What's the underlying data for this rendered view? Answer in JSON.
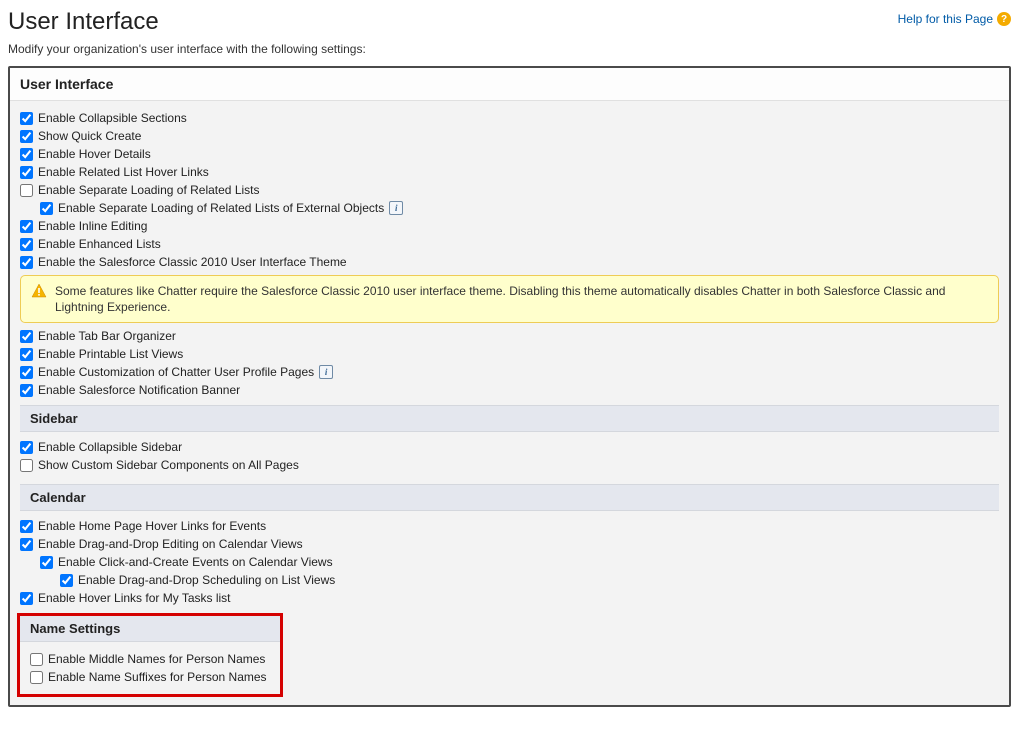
{
  "page": {
    "title": "User Interface",
    "help_link_text": "Help for this Page",
    "subtitle": "Modify your organization's user interface with the following settings:"
  },
  "sections": {
    "ui": {
      "header": "User Interface",
      "items": [
        {
          "label": "Enable Collapsible Sections",
          "checked": true,
          "indent": 0
        },
        {
          "label": "Show Quick Create",
          "checked": true,
          "indent": 0
        },
        {
          "label": "Enable Hover Details",
          "checked": true,
          "indent": 0
        },
        {
          "label": "Enable Related List Hover Links",
          "checked": true,
          "indent": 0
        },
        {
          "label": "Enable Separate Loading of Related Lists",
          "checked": false,
          "indent": 0
        },
        {
          "label": "Enable Separate Loading of Related Lists of External Objects",
          "checked": true,
          "indent": 1,
          "info": true
        },
        {
          "label": "Enable Inline Editing",
          "checked": true,
          "indent": 0
        },
        {
          "label": "Enable Enhanced Lists",
          "checked": true,
          "indent": 0
        },
        {
          "label": "Enable the Salesforce Classic 2010 User Interface Theme",
          "checked": true,
          "indent": 0
        }
      ],
      "warning": "Some features like Chatter require the Salesforce Classic 2010 user interface theme. Disabling this theme automatically disables Chatter in both Salesforce Classic and Lightning Experience.",
      "items2": [
        {
          "label": "Enable Tab Bar Organizer",
          "checked": true,
          "indent": 0
        },
        {
          "label": "Enable Printable List Views",
          "checked": true,
          "indent": 0
        },
        {
          "label": "Enable Customization of Chatter User Profile Pages",
          "checked": true,
          "indent": 0,
          "info": true
        },
        {
          "label": "Enable Salesforce Notification Banner",
          "checked": true,
          "indent": 0
        }
      ]
    },
    "sidebar": {
      "header": "Sidebar",
      "items": [
        {
          "label": "Enable Collapsible Sidebar",
          "checked": true,
          "indent": 0
        },
        {
          "label": "Show Custom Sidebar Components on All Pages",
          "checked": false,
          "indent": 0
        }
      ]
    },
    "calendar": {
      "header": "Calendar",
      "items": [
        {
          "label": "Enable Home Page Hover Links for Events",
          "checked": true,
          "indent": 0
        },
        {
          "label": "Enable Drag-and-Drop Editing on Calendar Views",
          "checked": true,
          "indent": 0
        },
        {
          "label": "Enable Click-and-Create Events on Calendar Views",
          "checked": true,
          "indent": 1
        },
        {
          "label": "Enable Drag-and-Drop Scheduling on List Views",
          "checked": true,
          "indent": 2
        },
        {
          "label": "Enable Hover Links for My Tasks list",
          "checked": true,
          "indent": 0
        }
      ]
    },
    "name_settings": {
      "header": "Name Settings",
      "items": [
        {
          "label": "Enable Middle Names for Person Names",
          "checked": false,
          "indent": 0
        },
        {
          "label": "Enable Name Suffixes for Person Names",
          "checked": false,
          "indent": 0
        }
      ]
    }
  }
}
